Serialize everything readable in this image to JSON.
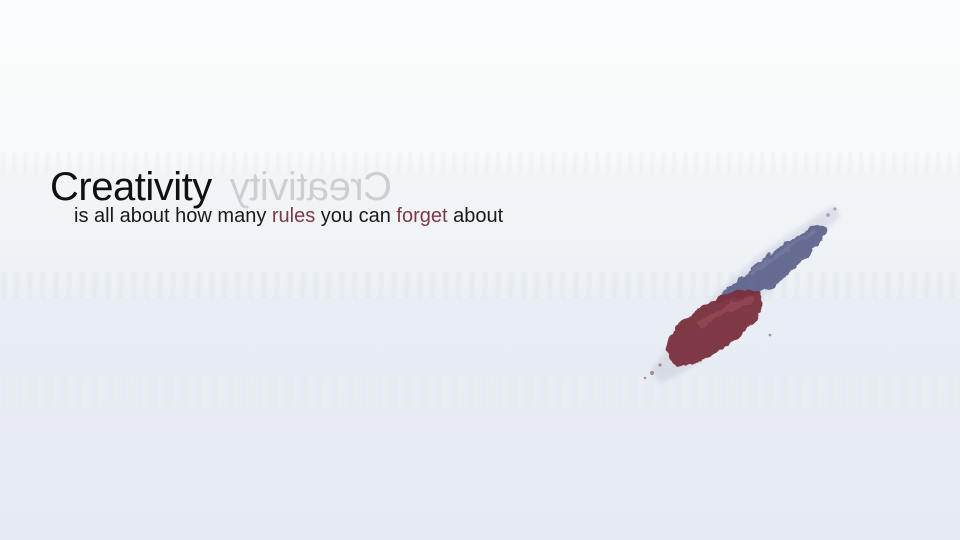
{
  "slide": {
    "headline": "Creativity",
    "headline_mirror": "Creativity",
    "tagline": {
      "part1": "is all about how many ",
      "accent1": "rules",
      "part2": " you can ",
      "accent2": "forget",
      "part3": " about"
    }
  },
  "colors": {
    "accent": "#7b3a45",
    "brush_blue": "#5c6189",
    "brush_red": "#7a2e3d"
  },
  "decoration": {
    "icon": "paint-brush-stroke"
  }
}
